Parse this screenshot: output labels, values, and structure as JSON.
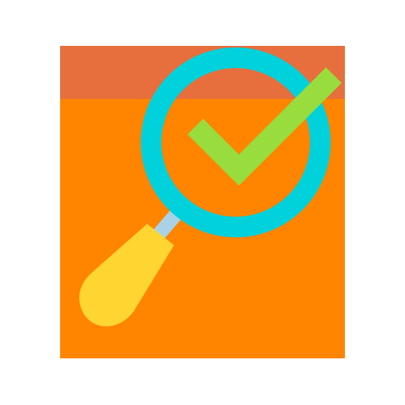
{
  "icon": {
    "name": "search-approved-document-icon",
    "colors": {
      "background": "#ffffff",
      "document_header": "#E76E3D",
      "document_body": "#FF8400",
      "lens_ring": "#00D1DB",
      "checkmark": "#98DC3D",
      "handle_neck": "#A9D2E6",
      "handle_grip": "#FFD531"
    }
  }
}
